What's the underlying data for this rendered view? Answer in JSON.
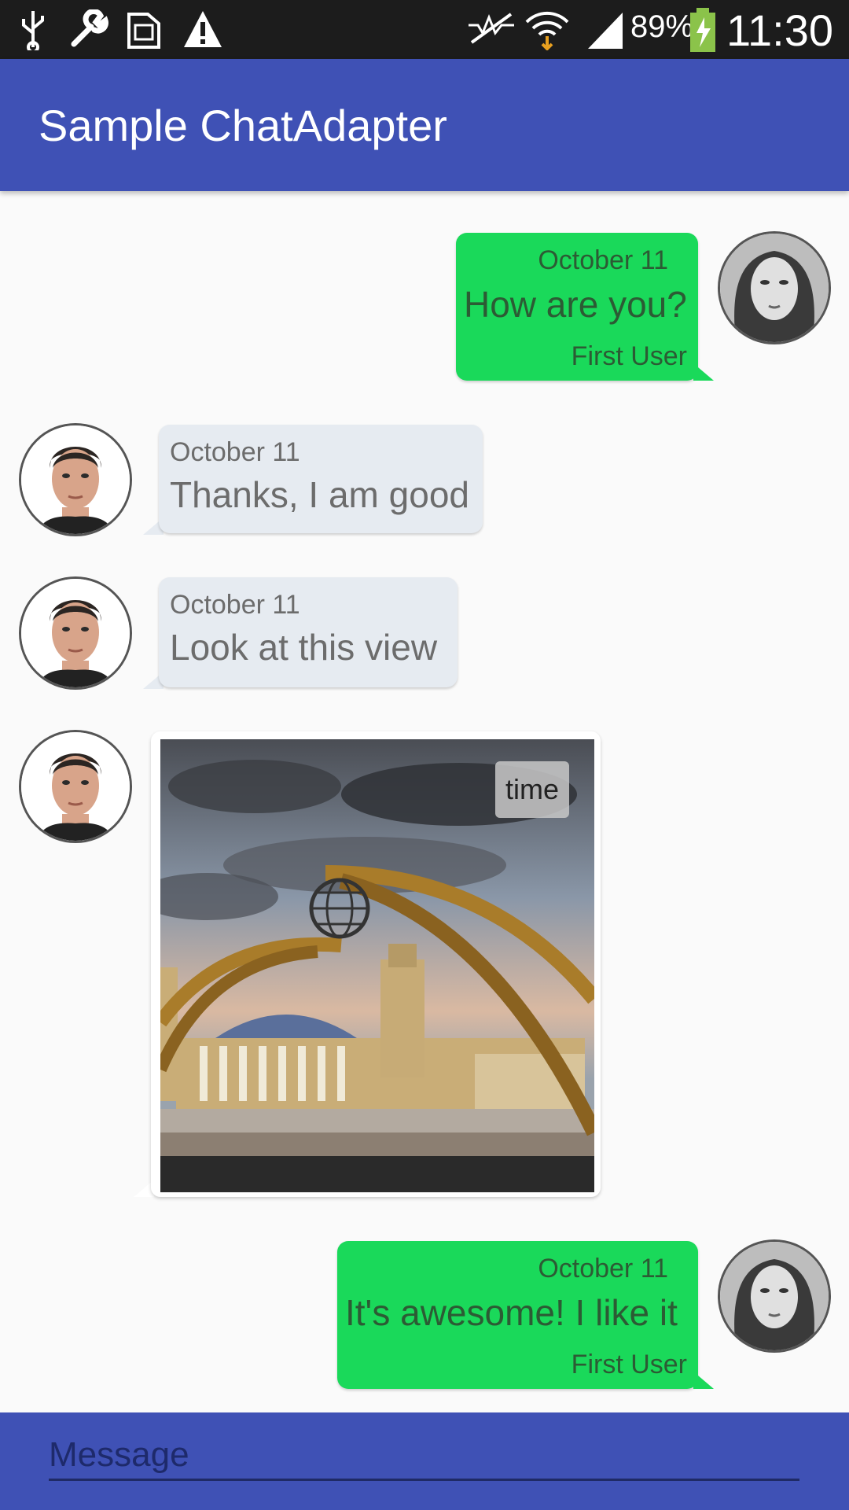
{
  "status_bar": {
    "battery": "89%",
    "time": "11:30"
  },
  "app_bar": {
    "title": "Sample ChatAdapter"
  },
  "messages": [
    {
      "direction": "outgoing",
      "date": "October 11",
      "text": "How are you?",
      "user": "First User"
    },
    {
      "direction": "incoming",
      "date": "October 11",
      "text": "Thanks, I am good"
    },
    {
      "direction": "incoming",
      "date": "October 11",
      "text": "Look at this view"
    },
    {
      "direction": "incoming",
      "type": "image",
      "badge": "time"
    },
    {
      "direction": "outgoing",
      "date": "October 11",
      "text": "It's awesome! I like it",
      "user": "First User"
    }
  ],
  "composer": {
    "placeholder": "Message"
  },
  "colors": {
    "app_bar": "#3f51b5",
    "outgoing_bubble": "#1ad95a",
    "incoming_bubble": "#e6ebf1"
  }
}
